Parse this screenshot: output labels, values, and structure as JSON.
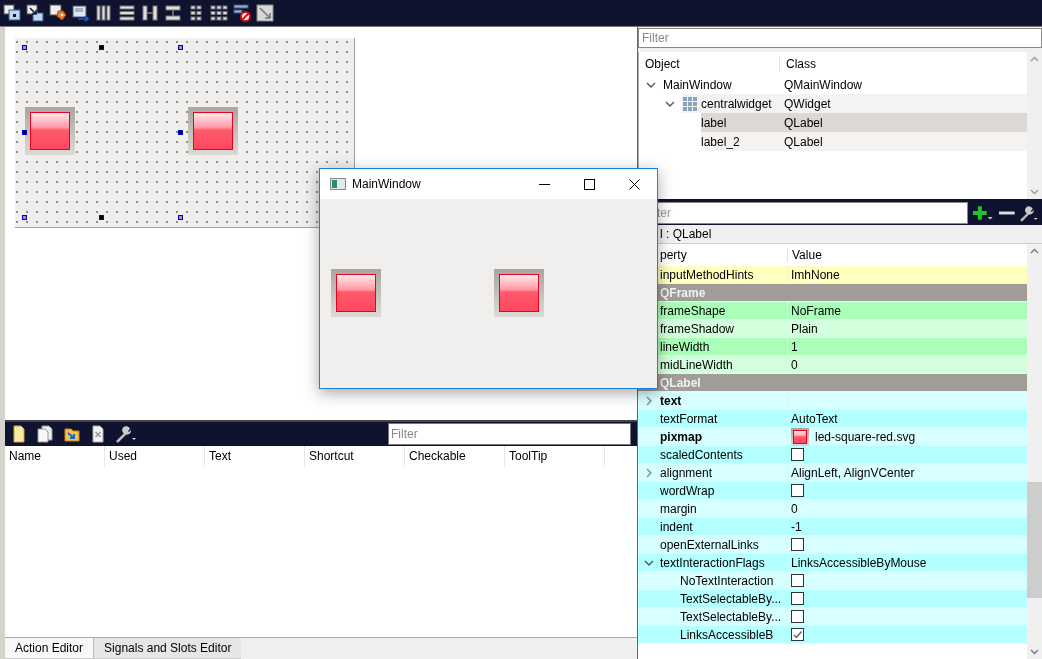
{
  "action_editor": {
    "filter": {
      "placeholder": "Filter"
    },
    "columns": [
      "Name",
      "Used",
      "Text",
      "Shortcut",
      "Checkable",
      "ToolTip"
    ],
    "tabs": [
      {
        "label": "Action Editor",
        "selected": true
      },
      {
        "label": "Signals and Slots Editor",
        "selected": false
      }
    ]
  },
  "object_inspector": {
    "filter": {
      "placeholder": "Filter"
    },
    "columns": [
      "Object",
      "Class"
    ],
    "tree": [
      {
        "object": "MainWindow",
        "class": "QMainWindow",
        "expanded": true,
        "selected": false,
        "children": [
          {
            "object": "centralwidget",
            "class": "QWidget",
            "kind": "layout",
            "expanded": true,
            "selected": false,
            "children": [
              {
                "object": "label",
                "class": "QLabel",
                "selected": true
              },
              {
                "object": "label_2",
                "class": "QLabel",
                "selected": false
              }
            ]
          }
        ]
      }
    ]
  },
  "property_editor": {
    "filter": {
      "placeholder": "ter"
    },
    "object_label": "l : QLabel",
    "columns": [
      "perty",
      "Value"
    ],
    "rows": [
      {
        "kind": "text",
        "name": "inputMethodHints",
        "value": "ImhNone",
        "modified": false,
        "color": "#ffffbf"
      },
      {
        "kind": "group",
        "name": "QFrame",
        "color": "#a09c97"
      },
      {
        "kind": "text",
        "name": "frameShape",
        "value": "NoFrame",
        "modified": false,
        "color": "#aaffb8"
      },
      {
        "kind": "text",
        "name": "frameShadow",
        "value": "Plain",
        "modified": false,
        "color": "#d4ffdc"
      },
      {
        "kind": "text",
        "name": "lineWidth",
        "value": "1",
        "modified": false,
        "color": "#aaffb8"
      },
      {
        "kind": "text",
        "name": "midLineWidth",
        "value": "0",
        "modified": false,
        "color": "#d4ffdc"
      },
      {
        "kind": "group",
        "name": "QLabel",
        "color": "#a09c97"
      },
      {
        "kind": "text",
        "name": "text",
        "modified": true,
        "expanded": false,
        "color": "#d8ffff"
      },
      {
        "kind": "text",
        "name": "textFormat",
        "value": "AutoText",
        "modified": false,
        "color": "#b4ffff"
      },
      {
        "kind": "pixmap",
        "name": "pixmap",
        "value": "led-square-red.svg",
        "modified": true,
        "color": "#d8ffff"
      },
      {
        "kind": "checkbox",
        "name": "scaledContents",
        "checked": false,
        "modified": false,
        "color": "#b4ffff"
      },
      {
        "kind": "text",
        "name": "alignment",
        "value": "AlignLeft, AlignVCenter",
        "modified": false,
        "expanded": false,
        "color": "#d8ffff"
      },
      {
        "kind": "checkbox",
        "name": "wordWrap",
        "checked": false,
        "modified": false,
        "color": "#b4ffff"
      },
      {
        "kind": "text",
        "name": "margin",
        "value": "0",
        "modified": false,
        "color": "#d8ffff"
      },
      {
        "kind": "text",
        "name": "indent",
        "value": "-1",
        "modified": false,
        "color": "#b4ffff"
      },
      {
        "kind": "checkbox",
        "name": "openExternalLinks",
        "checked": false,
        "modified": false,
        "color": "#d8ffff"
      },
      {
        "kind": "text",
        "name": "textInteractionFlags",
        "value": "LinksAccessibleByMouse",
        "modified": false,
        "expanded": true,
        "color": "#b4ffff",
        "children": [
          {
            "kind": "checkbox",
            "name": "NoTextInteraction",
            "checked": false,
            "modified": false,
            "color": "#d8ffff"
          },
          {
            "kind": "checkbox",
            "name": "TextSelectableBy...",
            "checked": false,
            "modified": false,
            "color": "#b4ffff"
          },
          {
            "kind": "checkbox",
            "name": "TextSelectableBy...",
            "checked": false,
            "modified": false,
            "color": "#d8ffff"
          },
          {
            "kind": "checkbox",
            "name": "LinksAccessibleB",
            "checked": true,
            "modified": false,
            "color": "#b4ffff"
          }
        ]
      }
    ]
  },
  "preview_window": {
    "title": "MainWindow"
  }
}
